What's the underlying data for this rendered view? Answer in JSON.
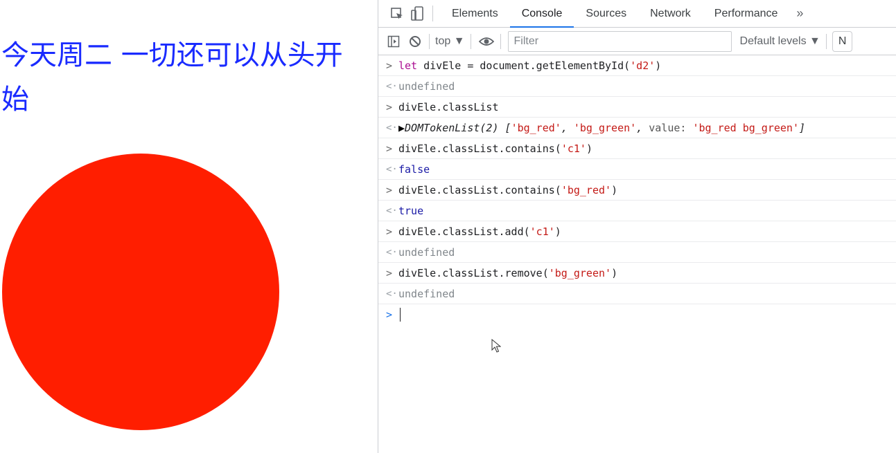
{
  "page": {
    "heading": "今天周二 一切还可以从头开始",
    "circle_color": "#ff1e00"
  },
  "devtools": {
    "tabs": [
      {
        "label": "Elements"
      },
      {
        "label": "Console",
        "active": true
      },
      {
        "label": "Sources"
      },
      {
        "label": "Network"
      },
      {
        "label": "Performance"
      }
    ],
    "more_tabs": "»",
    "toolbar": {
      "context": "top ▼",
      "filter_placeholder": "Filter",
      "levels": "Default levels ▼",
      "issues_label": "N"
    },
    "console": {
      "entries": [
        {
          "kind": "input",
          "marker": ">",
          "parts": [
            {
              "t": "let",
              "c": "kw"
            },
            {
              "t": " divEle = document.getElementById(",
              "c": "code"
            },
            {
              "t": "'d2'",
              "c": "str"
            },
            {
              "t": ")",
              "c": "code"
            }
          ]
        },
        {
          "kind": "output",
          "marker": "<·",
          "parts": [
            {
              "t": "undefined",
              "c": "undef"
            }
          ]
        },
        {
          "kind": "input",
          "marker": ">",
          "parts": [
            {
              "t": "divEle.classList",
              "c": "code"
            }
          ]
        },
        {
          "kind": "output",
          "marker": "<·",
          "parts": [
            {
              "t": "▶",
              "c": "arrow"
            },
            {
              "t": "DOMTokenList(2) [",
              "c": "obj"
            },
            {
              "t": "'bg_red'",
              "c": "str"
            },
            {
              "t": ", ",
              "c": "obj"
            },
            {
              "t": "'bg_green'",
              "c": "str"
            },
            {
              "t": ", ",
              "c": "obj"
            },
            {
              "t": "value: ",
              "c": "prop"
            },
            {
              "t": "'bg_red bg_green'",
              "c": "str"
            },
            {
              "t": "]",
              "c": "obj"
            }
          ]
        },
        {
          "kind": "input",
          "marker": ">",
          "parts": [
            {
              "t": "divEle.classList.contains(",
              "c": "code"
            },
            {
              "t": "'c1'",
              "c": "str"
            },
            {
              "t": ")",
              "c": "code"
            }
          ]
        },
        {
          "kind": "output",
          "marker": "<·",
          "parts": [
            {
              "t": "false",
              "c": "bool"
            }
          ]
        },
        {
          "kind": "input",
          "marker": ">",
          "parts": [
            {
              "t": "divEle.classList.contains(",
              "c": "code"
            },
            {
              "t": "'bg_red'",
              "c": "str"
            },
            {
              "t": ")",
              "c": "code"
            }
          ]
        },
        {
          "kind": "output",
          "marker": "<·",
          "parts": [
            {
              "t": "true",
              "c": "bool"
            }
          ]
        },
        {
          "kind": "input",
          "marker": ">",
          "parts": [
            {
              "t": "divEle.classList.add(",
              "c": "code"
            },
            {
              "t": "'c1'",
              "c": "str"
            },
            {
              "t": ")",
              "c": "code"
            }
          ]
        },
        {
          "kind": "output",
          "marker": "<·",
          "parts": [
            {
              "t": "undefined",
              "c": "undef"
            }
          ]
        },
        {
          "kind": "input",
          "marker": ">",
          "parts": [
            {
              "t": "divEle.classList.remove(",
              "c": "code"
            },
            {
              "t": "'bg_green'",
              "c": "str"
            },
            {
              "t": ")",
              "c": "code"
            }
          ]
        },
        {
          "kind": "output",
          "marker": "<·",
          "parts": [
            {
              "t": "undefined",
              "c": "undef"
            }
          ]
        }
      ],
      "prompt_marker": ">"
    }
  }
}
